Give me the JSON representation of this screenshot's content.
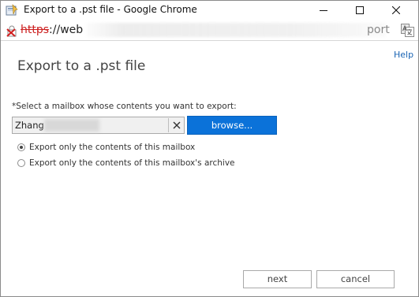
{
  "window": {
    "title": "Export to a .pst file - Google Chrome"
  },
  "address_bar": {
    "scheme": "https",
    "separator": "://",
    "host_visible": "web",
    "url_tail": "port"
  },
  "page": {
    "help_label": "Help",
    "title": "Export to a .pst file",
    "mailbox_label": "*Select a mailbox whose contents you want to export:",
    "mailbox_value": "Zhang",
    "browse_label": "browse...",
    "options": [
      {
        "label": "Export only the contents of this mailbox",
        "selected": true
      },
      {
        "label": "Export only the contents of this mailbox's archive",
        "selected": false
      }
    ],
    "next_label": "next",
    "cancel_label": "cancel"
  },
  "colors": {
    "accent": "#0b72d9",
    "link": "#1a64b4",
    "insecure": "#cc1f1f"
  },
  "icons": {
    "app": "pst-export-icon",
    "security": "not-secure-icon",
    "translate": "translate-icon",
    "clear": "close-icon"
  }
}
